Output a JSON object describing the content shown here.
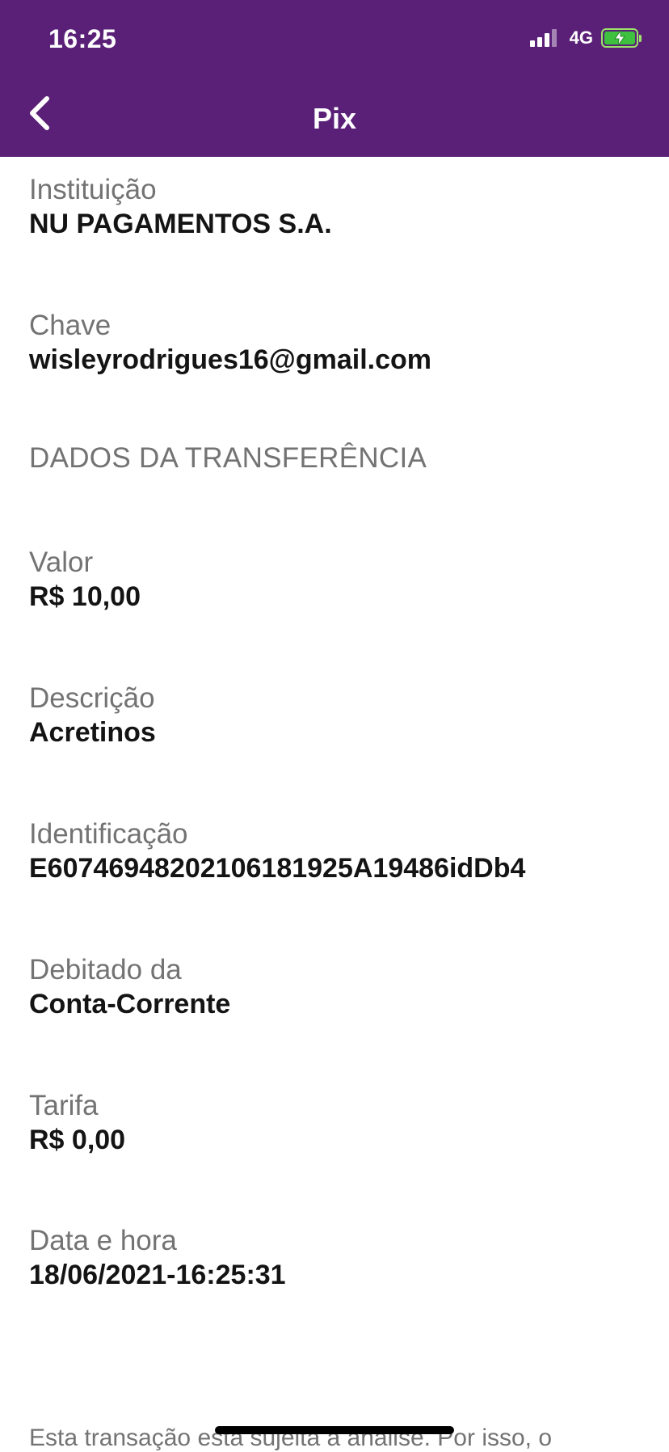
{
  "status_bar": {
    "time": "16:25",
    "network": "4G"
  },
  "header": {
    "title": "Pix",
    "background": "#5a2077"
  },
  "fields": {
    "instituicao": {
      "label": "Instituição",
      "value": "NU PAGAMENTOS S.A."
    },
    "chave": {
      "label": "Chave",
      "value": "wisleyrodrigues16@gmail.com"
    },
    "section": "DADOS DA TRANSFERÊNCIA",
    "valor": {
      "label": "Valor",
      "value": "R$ 10,00"
    },
    "descricao": {
      "label": "Descrição",
      "value": "Acretinos"
    },
    "identificacao": {
      "label": "Identificação",
      "value": "E60746948202106181925A19486idDb4"
    },
    "debitado": {
      "label": "Debitado da",
      "value": "Conta-Corrente"
    },
    "tarifa": {
      "label": "Tarifa",
      "value": "R$ 0,00"
    },
    "data_hora": {
      "label": "Data e hora",
      "value": "18/06/2021-16:25:31"
    }
  },
  "footer": {
    "note": "Esta transação está sujeita à análise. Por isso, o"
  }
}
